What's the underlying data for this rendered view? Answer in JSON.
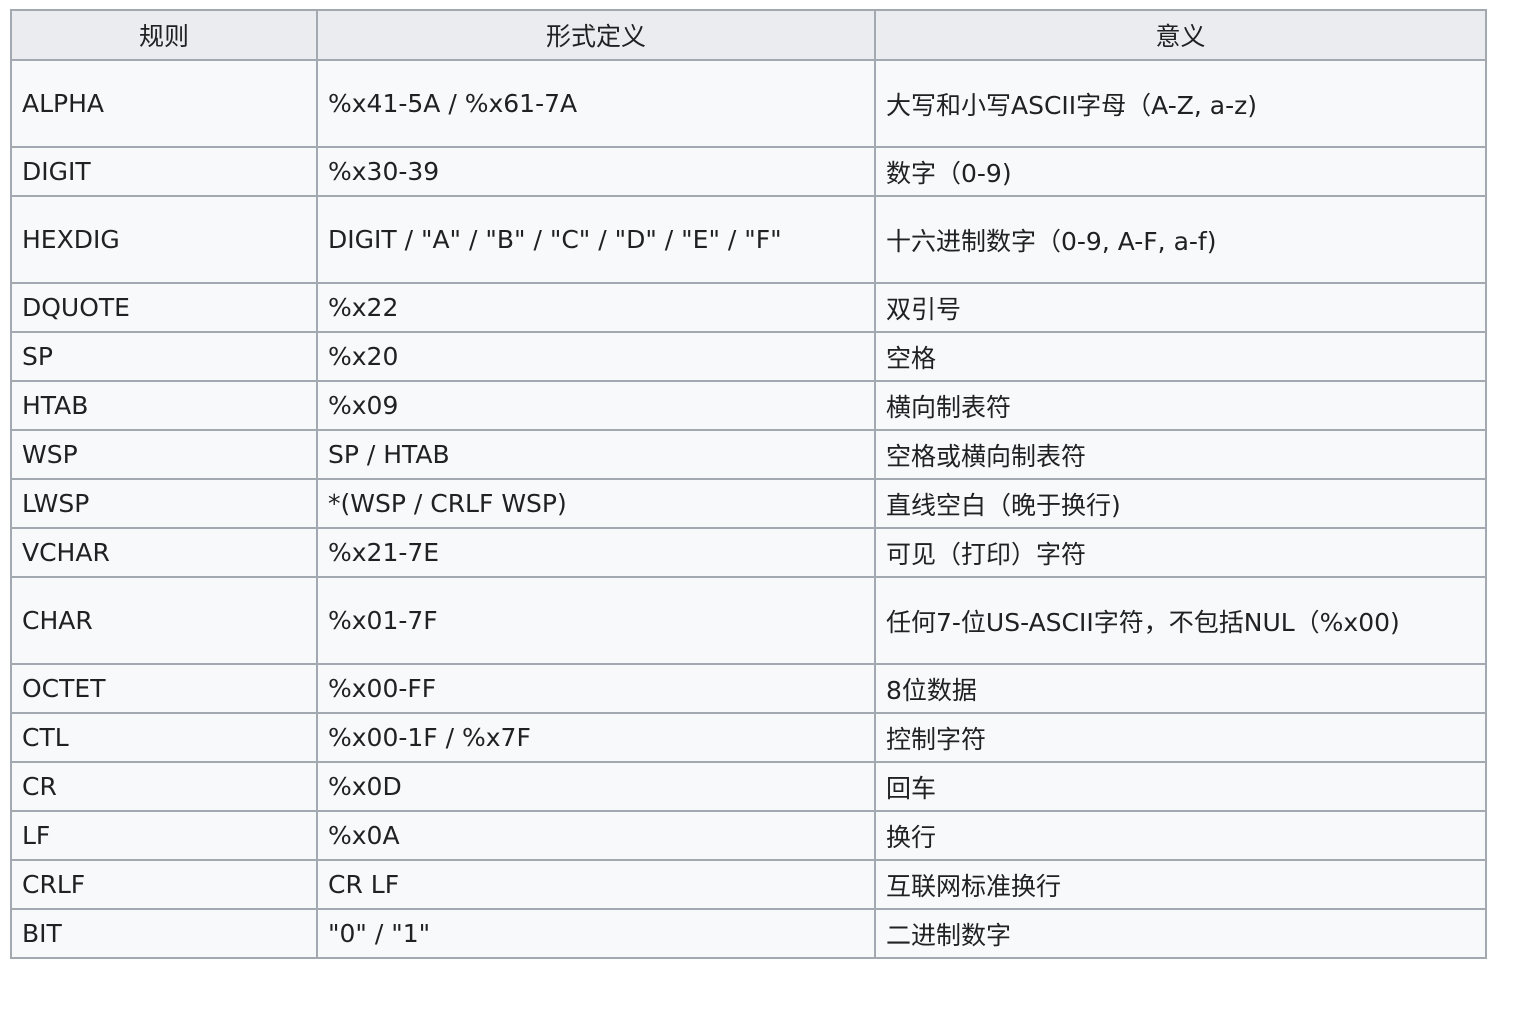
{
  "table": {
    "headers": [
      "规则",
      "形式定义",
      "意义"
    ],
    "rows": [
      {
        "rule": "ALPHA",
        "definition": "%x41-5A / %x61-7A",
        "meaning": "大写和小写ASCII字母（A-Z, a-z)"
      },
      {
        "rule": "DIGIT",
        "definition": "%x30-39",
        "meaning": "数字（0-9)"
      },
      {
        "rule": "HEXDIG",
        "definition": "DIGIT / \"A\" / \"B\" / \"C\" / \"D\" / \"E\" / \"F\"",
        "meaning": "十六进制数字（0-9, A-F, a-f)"
      },
      {
        "rule": "DQUOTE",
        "definition": "%x22",
        "meaning": "双引号"
      },
      {
        "rule": "SP",
        "definition": "%x20",
        "meaning": "空格"
      },
      {
        "rule": "HTAB",
        "definition": "%x09",
        "meaning": "横向制表符"
      },
      {
        "rule": "WSP",
        "definition": "SP / HTAB",
        "meaning": "空格或横向制表符"
      },
      {
        "rule": "LWSP",
        "definition": "*(WSP / CRLF WSP)",
        "meaning": "直线空白（晚于换行)"
      },
      {
        "rule": "VCHAR",
        "definition": "%x21-7E",
        "meaning": "可见（打印）字符"
      },
      {
        "rule": "CHAR",
        "definition": "%x01-7F",
        "meaning": "任何7-位US-ASCII字符，不包括NUL（%x00)"
      },
      {
        "rule": "OCTET",
        "definition": "%x00-FF",
        "meaning": "8位数据"
      },
      {
        "rule": "CTL",
        "definition": "%x00-1F / %x7F",
        "meaning": "控制字符"
      },
      {
        "rule": "CR",
        "definition": "%x0D",
        "meaning": "回车"
      },
      {
        "rule": "LF",
        "definition": "%x0A",
        "meaning": "换行"
      },
      {
        "rule": "CRLF",
        "definition": "CR LF",
        "meaning": "互联网标准换行"
      },
      {
        "rule": "BIT",
        "definition": "\"0\" / \"1\"",
        "meaning": "二进制数字"
      }
    ]
  }
}
